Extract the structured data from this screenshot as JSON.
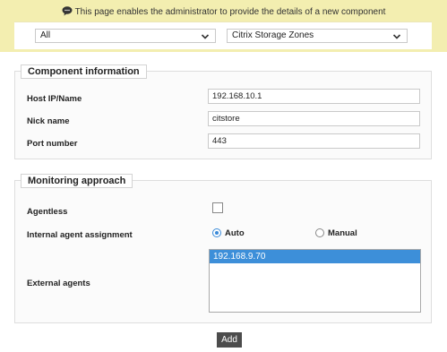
{
  "banner": {
    "message": "This page enables the administrator to provide the details of a new component",
    "icon": "comment-icon",
    "background": "#f3eeb0"
  },
  "filters": {
    "category_value": "All",
    "component_type_value": "Citrix Storage Zones"
  },
  "component_info": {
    "legend": "Component information",
    "host_label": "Host IP/Name",
    "host_value": "192.168.10.1",
    "nick_label": "Nick name",
    "nick_value": "citstore",
    "port_label": "Port number",
    "port_value": "443"
  },
  "monitoring": {
    "legend": "Monitoring approach",
    "agentless_label": "Agentless",
    "agentless_checked": false,
    "assignment_label": "Internal agent assignment",
    "auto_label": "Auto",
    "manual_label": "Manual",
    "assignment_selected": "Auto",
    "external_label": "External agents",
    "external_agents": [
      "192.168.9.70"
    ],
    "selected_color": "#3d8fd9"
  },
  "actions": {
    "add_label": "Add"
  }
}
